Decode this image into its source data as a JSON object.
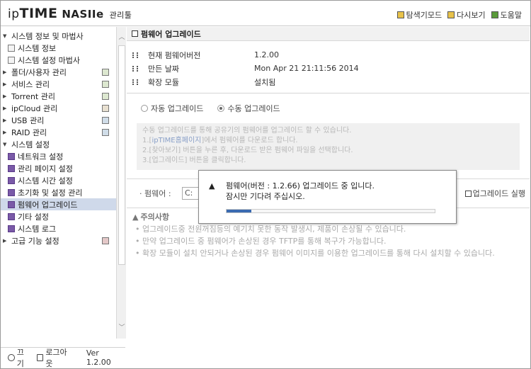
{
  "header": {
    "brand_prefix": "ip",
    "brand_main": "TIME",
    "model": "NASIIe",
    "tool_label": "관리툴",
    "links": [
      {
        "label": "탐색기모드",
        "icon": "explorer-icon"
      },
      {
        "label": "다시보기",
        "icon": "refresh-icon"
      },
      {
        "label": "도움말",
        "icon": "help-icon"
      }
    ]
  },
  "sidebar": {
    "items": [
      {
        "label": "시스템 정보 및 마법사",
        "level": 0,
        "expanded": true
      },
      {
        "label": "시스템 정보",
        "level": 1
      },
      {
        "label": "시스템 설정 마법사",
        "level": 1
      },
      {
        "label": "폴더/사용자 관리",
        "level": 0
      },
      {
        "label": "서비스 관리",
        "level": 0
      },
      {
        "label": "Torrent 관리",
        "level": 0
      },
      {
        "label": "ipCloud 관리",
        "level": 0
      },
      {
        "label": "USB 관리",
        "level": 0
      },
      {
        "label": "RAID 관리",
        "level": 0
      },
      {
        "label": "시스템 설정",
        "level": 0,
        "expanded": true
      },
      {
        "label": "네트워크 설정",
        "level": 1
      },
      {
        "label": "관리 페이지 설정",
        "level": 1
      },
      {
        "label": "시스템 시간 설정",
        "level": 1
      },
      {
        "label": "초기화 및 설정 관리",
        "level": 1
      },
      {
        "label": "펌웨어 업그레이드",
        "level": 1,
        "selected": true
      },
      {
        "label": "기타 설정",
        "level": 1
      },
      {
        "label": "시스템 로그",
        "level": 1
      },
      {
        "label": "고급 기능 설정",
        "level": 0
      }
    ],
    "footer": {
      "logout_label": "끄기",
      "logoff_label": "로그아웃",
      "version": "Ver 1.2.00"
    }
  },
  "main": {
    "title": "펌웨어 업그레이드",
    "info": [
      {
        "label": "현재 펌웨어버전",
        "value": "1.2.00"
      },
      {
        "label": "만든 날짜",
        "value": "Mon Apr 21 21:11:56 2014"
      },
      {
        "label": "확장 모듈",
        "value": "설치됨"
      }
    ],
    "modes": {
      "auto": "자동 업그레이드",
      "manual": "수동 업그레이드",
      "selected": "manual"
    },
    "description": {
      "line1": "수동 업그레이드를 통해 공유기의 펌웨어를 업그레이드 할 수 있습니다.",
      "line2_prefix": "1.[",
      "line2_link": "ipTIME홈페이지",
      "line2_suffix": "]에서 펌웨어를 다운로드 합니다.",
      "line3": "2.[찾아보기] 버튼을 누른 후, 다운로드 받은 펌웨어 파일을 선택합니다.",
      "line4": "3.[업그레이드] 버튼을 클릭합니다."
    },
    "firmware_label": "펌웨어 :",
    "firmware_input_value": "C:",
    "upgrade_button": "업그레이드 실행",
    "notice": {
      "title": "주의사항",
      "items": [
        "업그레이드중 전원꺼짐등의 예기치 못한 동작 발생시, 제품이 손상될 수 있습니다.",
        "만약 업그레이드 중 펌웨어가 손상된 경우 TFTP를 통해 복구가 가능합니다.",
        "확장 모듈이 설치 안되거나 손상된 경우 펌웨어 이미지를 이용한 업그레이드를 통해 다시 설치할 수 있습니다."
      ]
    }
  },
  "dialog": {
    "line1": "펌웨어(버전 : 1.2.66) 업그레이드 중 입니다.",
    "line2": "잠시만 기다려 주십시오.",
    "progress_fraction": 0.12
  }
}
